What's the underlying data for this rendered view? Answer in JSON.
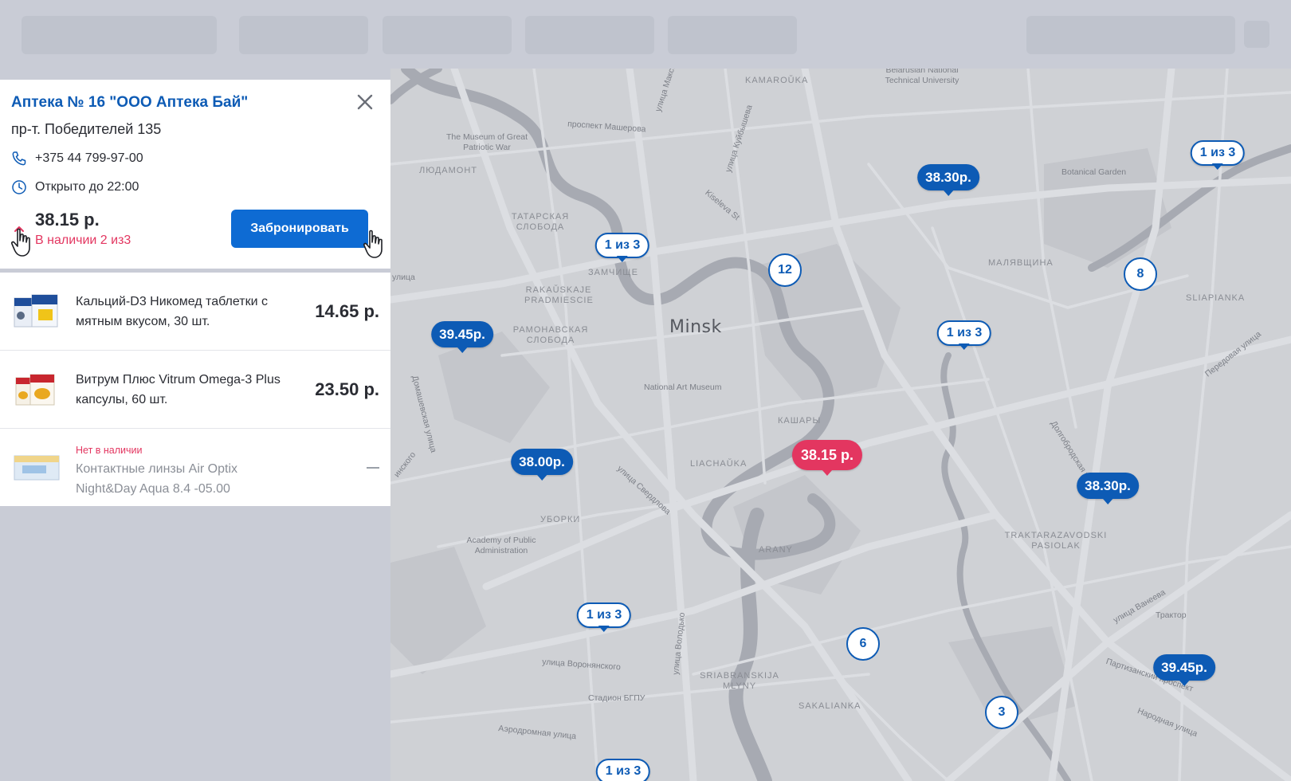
{
  "pharmacy": {
    "title": "Аптека № 16 \"ООО Аптека Бай\"",
    "address": "пр-т. Победителей 135",
    "phone": "+375 44 799-97-00",
    "hours": "Открыто до 22:00",
    "total_price": "38.15 р.",
    "availability": "В наличии 2 из3",
    "reserve_label": "Забронировать"
  },
  "items": [
    {
      "name": "Кальций-D3 Никомед таблетки с мятным вкусом, 30 шт.",
      "price": "14.65 р."
    },
    {
      "name": "Витрум Плюс Vitrum Omega-3 Plus капсулы, 60 шт.",
      "price": "23.50 р."
    },
    {
      "status": "Нет в наличии",
      "name": "Контактные линзы Air Optix Night&Day Aqua 8.4 -05.00",
      "price": ""
    }
  ],
  "map": {
    "city": "Minsk",
    "labels": {
      "kamarouka": "KAMAROŬKA",
      "bntu": "Belarusian National Technical University",
      "museum": "The Museum of Great Patriotic War",
      "masherova": "проспект Машерова",
      "bogdanovicha": "улица Максима Богданова",
      "kuibysheva": "улица Куйбышева",
      "kiseleva": "Kiseleva St",
      "ludamont": "ЛЮДАМОНТ",
      "tatar": "ТАТАРСКАЯ СЛОБОДА",
      "zamchysche": "ЗАМЧИЩЕ",
      "rakauskaje": "RAKAŬSKAJE PRADMIESCIE",
      "tramontana": "РАМОНАВСКАЯ СЛОБОДА",
      "botanical": "Botanical Garden",
      "malyavshchyna": "МАЛЯВЩИНА",
      "sliapianka": "SLIAPIANKA",
      "art_museum": "National Art Museum",
      "kashary": "КАШАРЫ",
      "liachauka": "LIACHAŬKA",
      "sverdlova": "улица Свердлова",
      "dolgobrodskaya": "Долгобродская улица",
      "peredovaya": "Передовая улица",
      "uborki": "УБОРКИ",
      "academy": "Academy of Public Administration",
      "arany": "ARANY",
      "traktar": "TRAKTARAZAVODSKI PASIOLAK",
      "vaneeva": "улица Ванеева",
      "traktor": "Трактор",
      "voronyanskogo": "улица Воронянского",
      "volodko": "улица Володько",
      "sriabranskija": "SRIABRANSKIJA MLYNY",
      "stadium": "Стадион БГПУ",
      "sakalianka": "SAKALIANKA",
      "partizansky": "Партизанский проспект",
      "narodnaya": "Народная улица",
      "aerodromnaya": "Аэродромная улица",
      "domashevskaya": "Домашевская улица",
      "street_a": "улица",
      "street_b": "инского"
    },
    "markers": [
      {
        "label": "1 из 3",
        "style": "outline"
      },
      {
        "label": "38.30р.",
        "style": "filled"
      },
      {
        "label": "1 из 3",
        "style": "outline"
      },
      {
        "label": "39.45р.",
        "style": "filled"
      },
      {
        "label": "1 из 3",
        "style": "outline"
      },
      {
        "label": "38.00р.",
        "style": "filled"
      },
      {
        "label": "38.15 р.",
        "style": "active"
      },
      {
        "label": "38.30р.",
        "style": "filled"
      },
      {
        "label": "1 из 3",
        "style": "outline"
      },
      {
        "label": "39.45р.",
        "style": "filled"
      },
      {
        "label": "1 из 3",
        "style": "outline"
      }
    ],
    "clusters": [
      "12",
      "8",
      "6",
      "3"
    ]
  },
  "colors": {
    "accent": "#0d5bb5",
    "active": "#e33660",
    "button": "#0e6bd3",
    "map_bg": "#cfd1d5"
  }
}
